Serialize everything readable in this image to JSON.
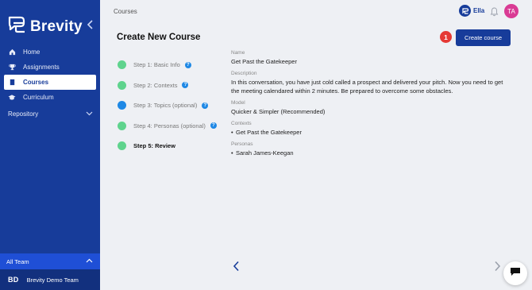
{
  "app": {
    "name": "Brevity"
  },
  "sidebar": {
    "items": [
      {
        "label": "Home",
        "icon": "home-icon"
      },
      {
        "label": "Assignments",
        "icon": "trophy-icon"
      },
      {
        "label": "Courses",
        "icon": "book-icon",
        "active": true
      },
      {
        "label": "Curriculum",
        "icon": "graduation-cap-icon"
      }
    ],
    "repository_label": "Repository",
    "team_selector": "All Team",
    "team": {
      "initials": "BD",
      "name": "Brevity Demo Team"
    }
  },
  "header": {
    "breadcrumb": "Courses",
    "user_name": "Ella",
    "avatar_initials": "TA"
  },
  "main": {
    "title": "Create New Course",
    "badge_count": "1",
    "create_button": "Create course",
    "steps": [
      {
        "label": "Step 1: Basic Info",
        "status": "complete",
        "help": true
      },
      {
        "label": "Step 2: Contexts",
        "status": "complete",
        "help": true
      },
      {
        "label": "Step 3: Topics (optional)",
        "status": "in-progress",
        "help": true
      },
      {
        "label": "Step 4: Personas (optional)",
        "status": "complete",
        "help": true
      },
      {
        "label": "Step 5: Review",
        "status": "current",
        "help": false
      }
    ],
    "review": {
      "name_label": "Name",
      "name_value": "Get Past the Gatekeeper",
      "description_label": "Description",
      "description_value": "In this conversation, you have just cold called a prospect and delivered your pitch. Now you need to get the meeting calendared within 2 minutes. Be prepared to overcome some obstacles.",
      "model_label": "Model",
      "model_value": "Quicker & Simpler (Recommended)",
      "contexts_label": "Contexts",
      "contexts": [
        "Get Past the Gatekeeper"
      ],
      "personas_label": "Personas",
      "personas": [
        "Sarah James-Keegan"
      ]
    }
  },
  "colors": {
    "sidebar": "#173c9a",
    "primary": "#173c9a",
    "step_complete": "#5fd38d",
    "step_in_progress": "#1e88e5",
    "badge": "#e53935",
    "avatar": "#d93b94"
  }
}
